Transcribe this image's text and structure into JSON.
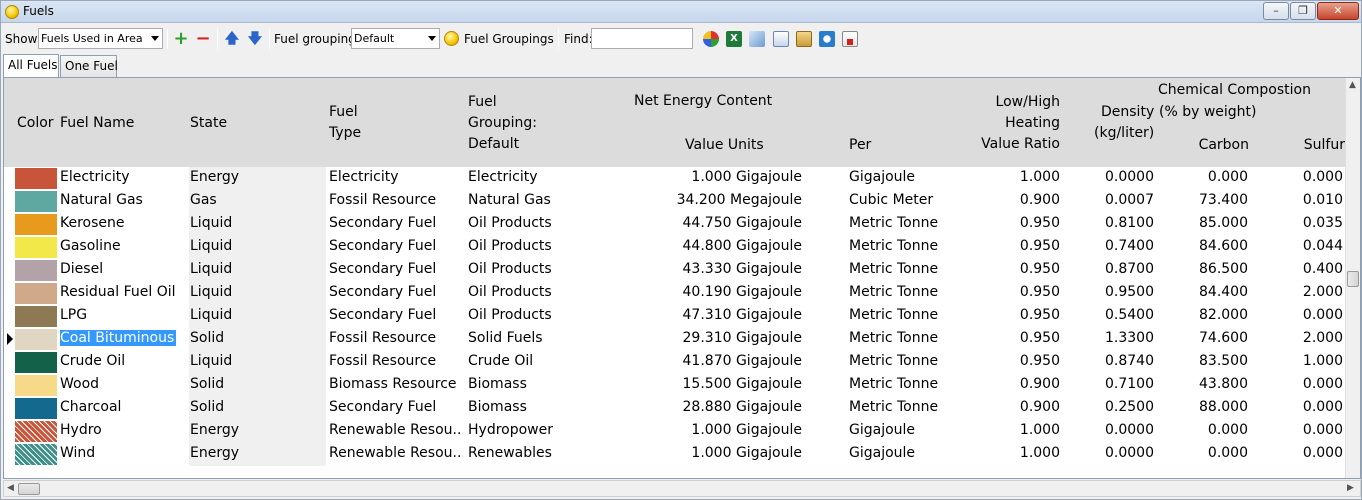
{
  "window": {
    "title": "Fuels"
  },
  "toolbar": {
    "show_label": "Show:",
    "show_value": "Fuels Used in Area",
    "fuel_grouping_label": "Fuel grouping:",
    "fuel_grouping_value": "Default",
    "fuel_groupings_button": "Fuel Groupings",
    "find_label": "Find:",
    "find_value": ""
  },
  "tabs": [
    {
      "label": "All Fuels",
      "active": true
    },
    {
      "label": "One Fuel",
      "active": false
    }
  ],
  "headers": {
    "color": "Color",
    "fuel_name": "Fuel Name",
    "state": "State",
    "fuel_type_1": "Fuel",
    "fuel_type_2": "Type",
    "grouping_1": "Fuel",
    "grouping_2": "Grouping:",
    "grouping_3": "Default",
    "net_energy": "Net Energy Content",
    "value_units": "Value Units",
    "per": "Per",
    "lh_1": "Low/High",
    "lh_2": "Heating",
    "lh_3": "Value Ratio",
    "density_1": "Density",
    "density_2": "(kg/liter)",
    "chem_1": "Chemical Compostion",
    "chem_2": "(% by weight)",
    "carbon": "Carbon",
    "sulfur": "Sulfur"
  },
  "rows": [
    {
      "color": "#c8553a",
      "pattern": "solid",
      "name": "Electricity",
      "state": "Energy",
      "type": "Electricity",
      "grouping": "Electricity",
      "value_units": "1.000 Gigajoule",
      "per": "Gigajoule",
      "ratio": "1.000",
      "density": "0.0000",
      "carbon": "0.000",
      "sulfur": "0.000"
    },
    {
      "color": "#5fa8a2",
      "pattern": "solid",
      "name": "Natural Gas",
      "state": "Gas",
      "type": "Fossil Resource",
      "grouping": "Natural Gas",
      "value_units": "34.200 Megajoule",
      "per": "Cubic Meter",
      "ratio": "0.900",
      "density": "0.0007",
      "carbon": "73.400",
      "sulfur": "0.010"
    },
    {
      "color": "#e89a1c",
      "pattern": "solid",
      "name": "Kerosene",
      "state": "Liquid",
      "type": "Secondary Fuel",
      "grouping": "Oil Products",
      "value_units": "44.750 Gigajoule",
      "per": "Metric Tonne",
      "ratio": "0.950",
      "density": "0.8100",
      "carbon": "85.000",
      "sulfur": "0.035"
    },
    {
      "color": "#f3e84a",
      "pattern": "solid",
      "name": "Gasoline",
      "state": "Liquid",
      "type": "Secondary Fuel",
      "grouping": "Oil Products",
      "value_units": "44.800 Gigajoule",
      "per": "Metric Tonne",
      "ratio": "0.950",
      "density": "0.7400",
      "carbon": "84.600",
      "sulfur": "0.044"
    },
    {
      "color": "#b3a3a8",
      "pattern": "solid",
      "name": "Diesel",
      "state": "Liquid",
      "type": "Secondary Fuel",
      "grouping": "Oil Products",
      "value_units": "43.330 Gigajoule",
      "per": "Metric Tonne",
      "ratio": "0.950",
      "density": "0.8700",
      "carbon": "86.500",
      "sulfur": "0.400"
    },
    {
      "color": "#cfa98a",
      "pattern": "solid",
      "name": "Residual Fuel Oil",
      "state": "Liquid",
      "type": "Secondary Fuel",
      "grouping": "Oil Products",
      "value_units": "40.190 Gigajoule",
      "per": "Metric Tonne",
      "ratio": "0.950",
      "density": "0.9500",
      "carbon": "84.400",
      "sulfur": "2.000"
    },
    {
      "color": "#8d7a55",
      "pattern": "solid",
      "name": "LPG",
      "state": "Liquid",
      "type": "Secondary Fuel",
      "grouping": "Oil Products",
      "value_units": "47.310 Gigajoule",
      "per": "Metric Tonne",
      "ratio": "0.950",
      "density": "0.5400",
      "carbon": "82.000",
      "sulfur": "0.000"
    },
    {
      "color": "#e0d6c2",
      "pattern": "solid",
      "name": "Coal Bituminous",
      "state": "Solid",
      "type": "Fossil Resource",
      "grouping": "Solid Fuels",
      "value_units": "29.310 Gigajoule",
      "per": "Metric Tonne",
      "ratio": "0.950",
      "density": "1.3300",
      "carbon": "74.600",
      "sulfur": "2.000",
      "selected": true
    },
    {
      "color": "#14614a",
      "pattern": "solid",
      "name": "Crude Oil",
      "state": "Liquid",
      "type": "Fossil Resource",
      "grouping": "Crude Oil",
      "value_units": "41.870 Gigajoule",
      "per": "Metric Tonne",
      "ratio": "0.950",
      "density": "0.8740",
      "carbon": "83.500",
      "sulfur": "1.000"
    },
    {
      "color": "#f7d98a",
      "pattern": "solid",
      "name": "Wood",
      "state": "Solid",
      "type": "Biomass Resource",
      "grouping": "Biomass",
      "value_units": "15.500 Gigajoule",
      "per": "Metric Tonne",
      "ratio": "0.900",
      "density": "0.7100",
      "carbon": "43.800",
      "sulfur": "0.000"
    },
    {
      "color": "#146a8e",
      "pattern": "solid",
      "name": "Charcoal",
      "state": "Solid",
      "type": "Secondary Fuel",
      "grouping": "Biomass",
      "value_units": "28.880 Gigajoule",
      "per": "Metric Tonne",
      "ratio": "0.900",
      "density": "0.2500",
      "carbon": "88.000",
      "sulfur": "0.000"
    },
    {
      "color": "#c8553a",
      "pattern": "hatch",
      "name": "Hydro",
      "state": "Energy",
      "type": "Renewable Resou...",
      "grouping": "Hydropower",
      "value_units": "1.000 Gigajoule",
      "per": "Gigajoule",
      "ratio": "1.000",
      "density": "0.0000",
      "carbon": "0.000",
      "sulfur": "0.000"
    },
    {
      "color": "#3d8f8a",
      "pattern": "hatch",
      "name": "Wind",
      "state": "Energy",
      "type": "Renewable Resou...",
      "grouping": "Renewables",
      "value_units": "1.000 Gigajoule",
      "per": "Gigajoule",
      "ratio": "1.000",
      "density": "0.0000",
      "carbon": "0.000",
      "sulfur": "0.000"
    }
  ]
}
